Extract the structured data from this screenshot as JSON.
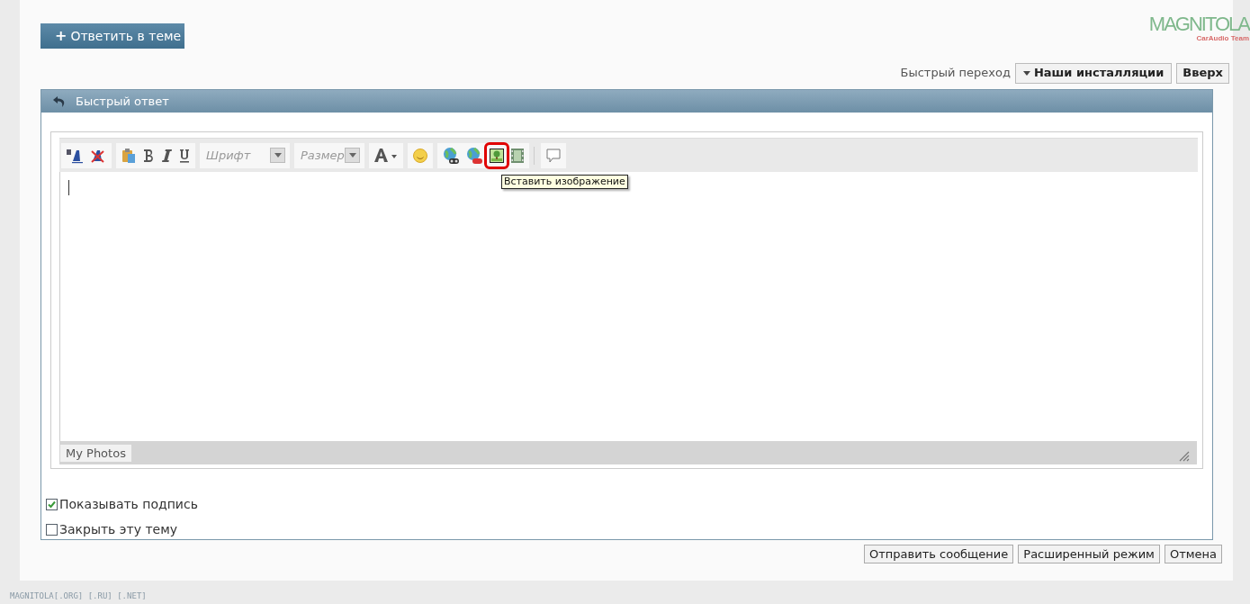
{
  "logo": {
    "title": "MAGNITOLA",
    "subtitle": "CarAudio Team"
  },
  "reply_button": {
    "icon": "+",
    "label": "Ответить в теме"
  },
  "quick_jump": {
    "label": "Быстрый переход",
    "dropdown": "Наши инсталляции",
    "top_button": "Вверх"
  },
  "panel": {
    "title": "Быстрый ответ"
  },
  "toolbar": {
    "groups": [
      {
        "tools": [
          {
            "kind": "font-size",
            "highlighted": false
          },
          {
            "kind": "remove-format",
            "highlighted": false
          }
        ]
      },
      {
        "tools": [
          {
            "kind": "paste",
            "highlighted": false
          },
          {
            "kind": "bold",
            "highlighted": false
          },
          {
            "kind": "italic",
            "highlighted": false
          },
          {
            "kind": "underline",
            "highlighted": false
          }
        ]
      },
      {
        "tools": [
          {
            "kind": "font-select",
            "placeholder": "Шрифт",
            "highlighted": false
          }
        ]
      },
      {
        "tools": [
          {
            "kind": "size-select",
            "placeholder": "Размер",
            "highlighted": false
          }
        ]
      },
      {
        "tools": [
          {
            "kind": "text-color",
            "highlighted": false
          }
        ]
      },
      {
        "tools": [
          {
            "kind": "smiley",
            "highlighted": false
          }
        ]
      },
      {
        "tools": [
          {
            "kind": "link",
            "highlighted": false
          },
          {
            "kind": "unlink",
            "highlighted": false
          },
          {
            "kind": "image",
            "highlighted": true
          },
          {
            "kind": "video",
            "highlighted": false
          }
        ]
      },
      {
        "tools": [
          {
            "kind": "quote",
            "highlighted": false
          }
        ]
      }
    ]
  },
  "tooltip": "Вставить изображение",
  "editor_tab": "My Photos",
  "options": [
    {
      "label": "Показывать подпись",
      "checked": true
    },
    {
      "label": "Закрыть эту тему",
      "checked": false
    }
  ],
  "buttons": [
    "Отправить сообщение",
    "Расширенный режим",
    "Отмена"
  ],
  "footer": "MAGNITOLA[.ORG] [.RU] [.NET]"
}
